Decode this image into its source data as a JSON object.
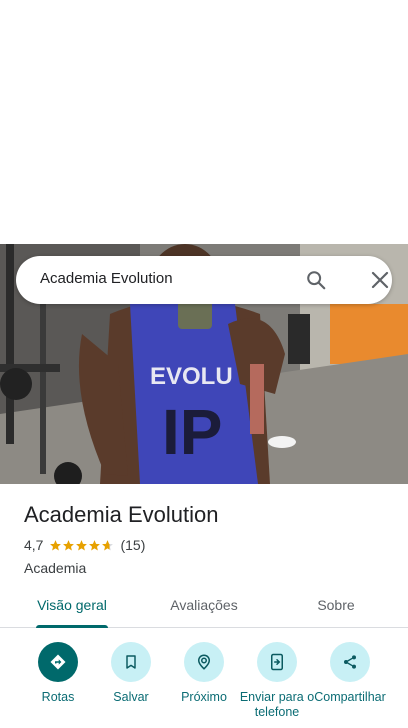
{
  "search": {
    "query": "Academia Evolution"
  },
  "place": {
    "name": "Academia Evolution",
    "rating": "4,7",
    "stars": 4.7,
    "reviews": "(15)",
    "category": "Academia"
  },
  "tabs": [
    {
      "label": "Visão geral",
      "active": true
    },
    {
      "label": "Avaliações",
      "active": false
    },
    {
      "label": "Sobre",
      "active": false
    }
  ],
  "actions": [
    {
      "label": "Rotas",
      "icon": "directions-icon"
    },
    {
      "label": "Salvar",
      "icon": "bookmark-icon"
    },
    {
      "label": "Próximo",
      "icon": "nearby-icon"
    },
    {
      "label": "Enviar para o telefone",
      "icon": "send-to-phone-icon"
    },
    {
      "label": "Compartilhar",
      "icon": "share-icon"
    }
  ],
  "colors": {
    "accent": "#00696b",
    "action_bg": "#c8f0f5",
    "star": "#e7a100"
  }
}
